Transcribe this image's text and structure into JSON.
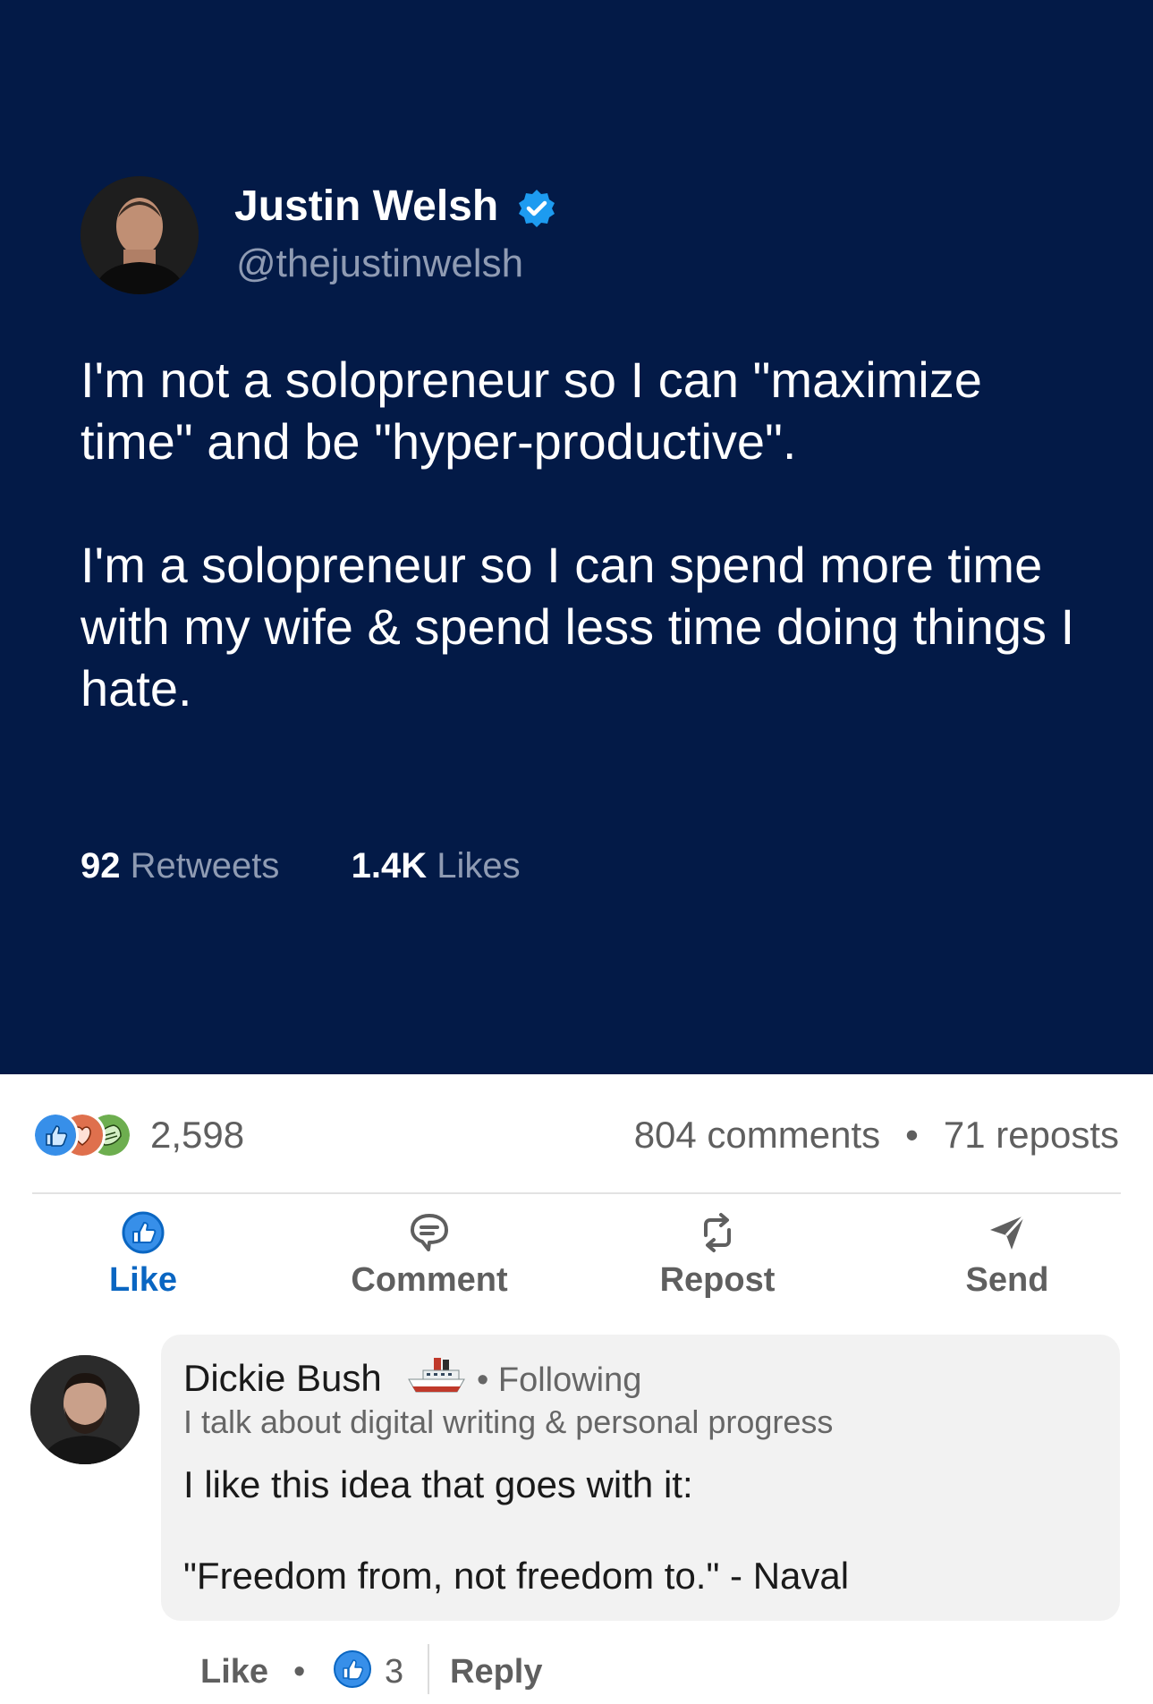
{
  "tweet": {
    "author_name": "Justin Welsh",
    "handle": "@thejustinwelsh",
    "paragraphs": [
      "I'm not a solopreneur so I can \"maximize time\" and be \"hyper-productive\".",
      "I'm a solopreneur so I can spend more time with my wife & spend less time doing things I hate."
    ],
    "retweets_count": "92",
    "retweets_label": "Retweets",
    "likes_count": "1.4K",
    "likes_label": "Likes",
    "background_color": "#031a47",
    "verified_color": "#1d9bf0"
  },
  "engagement": {
    "reaction_count": "2,598",
    "reaction_icons": [
      "like-icon",
      "love-icon",
      "support-icon"
    ],
    "comments": "804 comments",
    "separator": "•",
    "reposts": "71 reposts"
  },
  "actions": [
    {
      "label": "Like",
      "icon": "thumbs-up-icon",
      "active": true
    },
    {
      "label": "Comment",
      "icon": "comment-icon",
      "active": false
    },
    {
      "label": "Repost",
      "icon": "repost-icon",
      "active": false
    },
    {
      "label": "Send",
      "icon": "send-icon",
      "active": false
    }
  ],
  "comment": {
    "author_name": "Dickie Bush",
    "author_emoji": "ship-icon",
    "following": "• Following",
    "headline": "I talk about digital writing & personal progress",
    "paragraphs": [
      "I like this idea that goes with it:",
      "\"Freedom from, not freedom to.\" - Naval"
    ],
    "like_label": "Like",
    "dot": "•",
    "like_count": "3",
    "reply_label": "Reply"
  },
  "colors": {
    "accent": "#0a66c2",
    "muted_text": "#5f5f5f"
  }
}
